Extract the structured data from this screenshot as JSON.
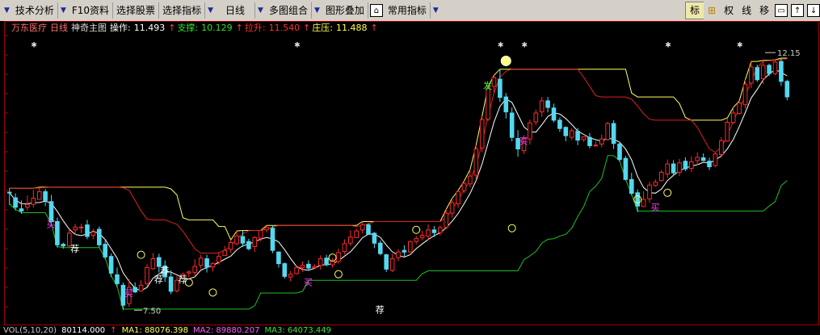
{
  "toolbar": {
    "items": [
      {
        "label": "技术分析"
      },
      {
        "label": "F10资料"
      },
      {
        "label": "选择股票"
      },
      {
        "label": "选择指标"
      },
      {
        "label": "日线"
      },
      {
        "label": "多图组合"
      },
      {
        "label": "图形叠加"
      },
      {
        "label": "常用指标"
      }
    ],
    "right": {
      "biao": "标",
      "plus": "⊞",
      "quan": "权",
      "xian": "线",
      "yi": "移"
    }
  },
  "info": {
    "stock_name": "万东医疗",
    "period": "日线",
    "indicator": "神奇主图",
    "op_label": "操作:",
    "op_value": "11.493",
    "sup_label": "支撑:",
    "sup_value": "10.129",
    "pull_label": "拉升:",
    "pull_value": "11.540",
    "press_label": "庄压:",
    "press_value": "11.488",
    "up_arrow": "↑"
  },
  "chart": {
    "high_label": "12.15",
    "low_label": "7.50",
    "price_range": [
      7.3,
      12.4
    ],
    "colors": {
      "up": "#ff2a2a",
      "down": "#54d8f0",
      "upper": "#ffff60",
      "mid": "#e02020",
      "lower": "#20c020",
      "ma": "#ffffff"
    },
    "candles": [
      [
        9.63,
        9.62,
        9.7,
        9.4
      ],
      [
        9.53,
        9.36,
        9.61,
        9.3
      ],
      [
        9.33,
        9.29,
        9.48,
        9.24
      ],
      [
        9.36,
        9.41,
        9.57,
        9.3
      ],
      [
        9.41,
        9.52,
        9.67,
        9.35
      ],
      [
        9.5,
        9.64,
        9.72,
        9.54
      ],
      [
        9.64,
        9.48,
        9.69,
        9.38
      ],
      [
        9.46,
        9.1,
        9.58,
        9.04
      ],
      [
        9.1,
        8.68,
        9.17,
        8.63
      ],
      [
        8.69,
        8.66,
        8.72,
        8.61
      ],
      [
        8.66,
        8.89,
        8.96,
        8.63
      ],
      [
        8.95,
        9.0,
        9.06,
        8.86
      ],
      [
        8.99,
        9.0,
        9.06,
        8.89
      ],
      [
        9.04,
        8.83,
        9.13,
        8.78
      ],
      [
        8.85,
        8.91,
        8.97,
        8.78
      ],
      [
        8.96,
        8.68,
        9.01,
        8.63
      ],
      [
        8.69,
        8.46,
        8.76,
        8.42
      ],
      [
        8.47,
        8.17,
        8.52,
        8.1
      ],
      [
        8.14,
        7.98,
        8.27,
        7.91
      ],
      [
        7.95,
        7.59,
        8.0,
        7.5
      ],
      [
        7.62,
        7.91,
        8.06,
        7.56
      ],
      [
        7.91,
        7.83,
        8.0,
        7.81
      ],
      [
        7.85,
        7.95,
        8.04,
        7.83
      ],
      [
        7.98,
        8.27,
        8.33,
        7.93
      ],
      [
        8.25,
        8.43,
        8.53,
        8.23
      ],
      [
        8.45,
        8.29,
        8.52,
        8.18
      ],
      [
        8.3,
        8.1,
        8.4,
        8.01
      ],
      [
        8.1,
        7.84,
        8.22,
        7.79
      ],
      [
        7.85,
        8.04,
        8.12,
        7.82
      ],
      [
        8.08,
        8.15,
        8.18,
        8.08
      ],
      [
        8.17,
        8.19,
        8.22,
        8.09
      ],
      [
        8.18,
        8.29,
        8.42,
        8.11
      ],
      [
        8.31,
        8.44,
        8.5,
        8.25
      ],
      [
        8.43,
        8.28,
        8.5,
        8.18
      ],
      [
        8.28,
        8.34,
        8.37,
        8.2
      ],
      [
        8.37,
        8.47,
        8.55,
        8.32
      ],
      [
        8.49,
        8.58,
        8.66,
        8.49
      ],
      [
        8.6,
        8.72,
        8.77,
        8.53
      ],
      [
        8.7,
        8.84,
        8.93,
        8.67
      ],
      [
        8.83,
        8.71,
        8.94,
        8.64
      ],
      [
        8.74,
        8.61,
        8.79,
        8.58
      ],
      [
        8.65,
        8.81,
        8.84,
        8.55
      ],
      [
        8.8,
        8.94,
        8.94,
        8.74
      ],
      [
        8.95,
        8.99,
        9.03,
        8.9
      ],
      [
        8.98,
        8.58,
        9.03,
        8.53
      ],
      [
        8.55,
        8.34,
        8.56,
        8.27
      ],
      [
        8.34,
        8.11,
        8.36,
        8.07
      ],
      [
        8.1,
        8.15,
        8.21,
        8.02
      ],
      [
        8.16,
        8.27,
        8.3,
        8.14
      ],
      [
        8.27,
        8.31,
        8.38,
        8.19
      ],
      [
        8.33,
        8.26,
        8.4,
        8.22
      ],
      [
        8.27,
        8.29,
        8.33,
        8.24
      ],
      [
        8.31,
        8.43,
        8.49,
        8.23
      ],
      [
        8.44,
        8.32,
        8.5,
        8.29
      ],
      [
        8.32,
        8.39,
        8.44,
        8.27
      ],
      [
        8.38,
        8.54,
        8.61,
        8.34
      ],
      [
        8.56,
        8.7,
        8.78,
        8.51
      ],
      [
        8.71,
        8.82,
        8.94,
        8.66
      ],
      [
        8.81,
        8.93,
        8.97,
        8.81
      ],
      [
        8.95,
        9.04,
        9.1,
        8.89
      ],
      [
        9.04,
        8.87,
        9.07,
        8.86
      ],
      [
        8.89,
        8.71,
        8.91,
        8.62
      ],
      [
        8.71,
        8.52,
        8.76,
        8.49
      ],
      [
        8.5,
        8.24,
        8.52,
        8.19
      ],
      [
        8.22,
        8.43,
        8.52,
        8.19
      ],
      [
        8.45,
        8.55,
        8.6,
        8.39
      ],
      [
        8.58,
        8.55,
        8.67,
        8.46
      ],
      [
        8.55,
        8.74,
        8.76,
        8.54
      ],
      [
        8.74,
        8.79,
        8.84,
        8.69
      ],
      [
        8.81,
        8.85,
        8.93,
        8.76
      ],
      [
        8.84,
        8.95,
        9.05,
        8.77
      ],
      [
        8.95,
        8.9,
        9.02,
        8.82
      ],
      [
        8.9,
        8.99,
        9.03,
        8.85
      ],
      [
        9.0,
        9.25,
        9.32,
        8.96
      ],
      [
        9.25,
        9.44,
        9.52,
        9.17
      ],
      [
        9.42,
        9.64,
        9.66,
        9.35
      ],
      [
        9.66,
        9.79,
        9.83,
        9.62
      ],
      [
        9.78,
        9.92,
        10.04,
        9.72
      ],
      [
        9.94,
        10.41,
        10.48,
        9.86
      ],
      [
        10.43,
        10.94,
        11.0,
        10.35
      ],
      [
        10.95,
        11.51,
        11.53,
        10.91
      ],
      [
        11.54,
        11.7,
        11.74,
        11.42
      ],
      [
        11.67,
        11.34,
        11.85,
        11.26
      ],
      [
        11.35,
        11.08,
        11.42,
        10.96
      ],
      [
        11.06,
        10.62,
        11.16,
        10.55
      ],
      [
        10.6,
        10.41,
        10.75,
        10.27
      ],
      [
        10.38,
        10.6,
        10.66,
        10.32
      ],
      [
        10.59,
        10.88,
        10.94,
        10.49
      ],
      [
        10.9,
        11.06,
        11.12,
        10.84
      ],
      [
        11.08,
        11.28,
        11.35,
        10.99
      ],
      [
        11.28,
        11.16,
        11.35,
        11.07
      ],
      [
        11.15,
        10.93,
        11.23,
        10.89
      ],
      [
        10.93,
        10.78,
        10.98,
        10.72
      ],
      [
        10.8,
        10.65,
        10.82,
        10.55
      ],
      [
        10.62,
        10.74,
        10.78,
        10.57
      ],
      [
        10.73,
        10.57,
        10.79,
        10.48
      ],
      [
        10.58,
        10.63,
        10.63,
        10.54
      ],
      [
        10.62,
        10.47,
        10.7,
        10.42
      ],
      [
        10.47,
        10.48,
        10.55,
        10.46
      ],
      [
        10.5,
        10.59,
        10.67,
        10.44
      ],
      [
        10.58,
        10.87,
        10.9,
        10.56
      ],
      [
        10.87,
        10.51,
        10.93,
        10.41
      ],
      [
        10.5,
        10.22,
        10.54,
        10.18
      ],
      [
        10.24,
        9.86,
        10.29,
        9.84
      ],
      [
        9.86,
        9.61,
        9.98,
        9.57
      ],
      [
        9.62,
        9.38,
        9.68,
        9.27
      ],
      [
        9.37,
        9.5,
        9.65,
        9.36
      ],
      [
        9.51,
        9.76,
        9.82,
        9.44
      ],
      [
        9.75,
        9.81,
        9.86,
        9.73
      ],
      [
        9.84,
        9.99,
        10.03,
        9.82
      ],
      [
        9.96,
        10.14,
        10.22,
        9.89
      ],
      [
        10.14,
        9.98,
        10.21,
        9.92
      ],
      [
        9.99,
        10.16,
        10.23,
        9.92
      ],
      [
        10.19,
        10.05,
        10.26,
        10.01
      ],
      [
        10.06,
        10.18,
        10.28,
        10.0
      ],
      [
        10.2,
        10.26,
        10.35,
        10.12
      ],
      [
        10.25,
        10.2,
        10.33,
        10.19
      ],
      [
        10.19,
        10.09,
        10.25,
        10.03
      ],
      [
        10.11,
        10.32,
        10.35,
        10.08
      ],
      [
        10.31,
        10.56,
        10.62,
        10.25
      ],
      [
        10.55,
        10.89,
        10.97,
        10.54
      ],
      [
        10.89,
        11.06,
        11.16,
        10.86
      ],
      [
        11.05,
        11.24,
        11.28,
        11.03
      ],
      [
        11.21,
        11.58,
        11.66,
        11.14
      ],
      [
        11.6,
        11.89,
        11.99,
        11.51
      ],
      [
        11.88,
        11.66,
        11.93,
        11.62
      ],
      [
        11.68,
        11.92,
        12.01,
        11.58
      ],
      [
        11.92,
        11.77,
        11.95,
        11.73
      ],
      [
        11.77,
        11.98,
        12.02,
        11.74
      ],
      [
        11.99,
        11.63,
        12.05,
        11.55
      ],
      [
        11.63,
        11.35,
        11.66,
        11.29
      ]
    ]
  },
  "signals": {
    "buy": "买",
    "rec": "荐",
    "fa": "发"
  },
  "vol": {
    "label": "VOL(5,10,20)",
    "vol_value": "80114.000",
    "arrow": "↑",
    "ma1": "MA1: 88076.398",
    "ma2": "MA2: 89880.207",
    "ma3": "MA3: 64073.449"
  }
}
